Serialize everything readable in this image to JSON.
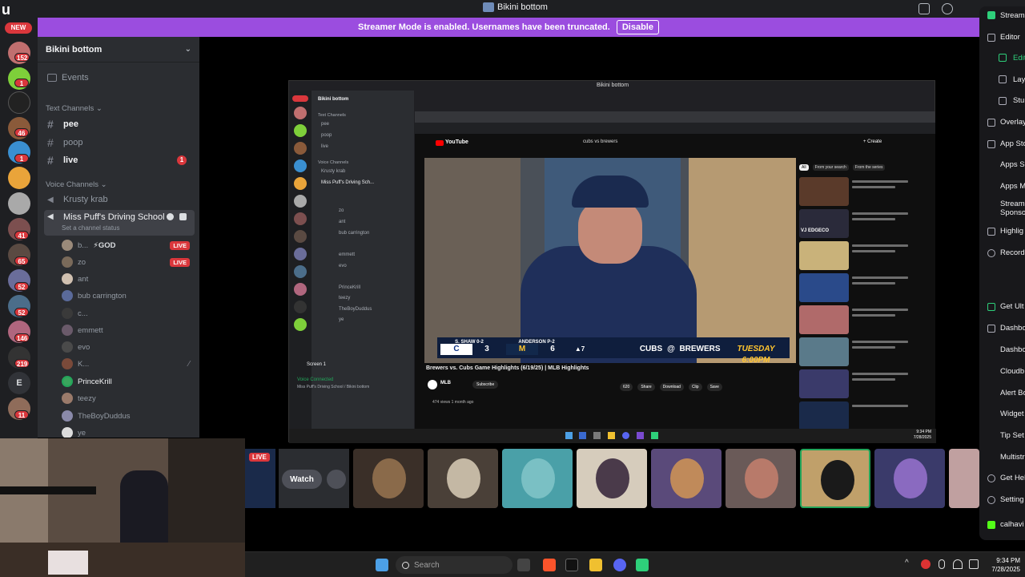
{
  "window": {
    "app_letter": "u",
    "title": "Bikini bottom"
  },
  "banner": {
    "message": "Streamer Mode is enabled. Usernames have been truncated.",
    "disable_label": "Disable"
  },
  "rail": {
    "new_label": "NEW",
    "badges": [
      "152",
      "1",
      "46",
      "1",
      "41",
      "65",
      "52",
      "52",
      "146",
      "219",
      "11"
    ],
    "letter_server": "E"
  },
  "sidebar": {
    "server_name": "Bikini bottom",
    "events_label": "Events",
    "text_category": "Text Channels",
    "text_channels": [
      {
        "name": "pee",
        "bright": true
      },
      {
        "name": "poop",
        "bright": false
      },
      {
        "name": "live",
        "bright": true,
        "badge": "1"
      }
    ],
    "voice_category": "Voice Channels",
    "voice_channels": [
      {
        "name": "Krusty krab"
      },
      {
        "name": "Miss Puff's Driving School",
        "status": "Set a channel status"
      }
    ],
    "voice_users": [
      {
        "name": "b...",
        "extra": "⚡GOD",
        "live": "LIVE"
      },
      {
        "name": "zo",
        "live": "LIVE"
      },
      {
        "name": "ant"
      },
      {
        "name": "bub carrington"
      },
      {
        "name": "c..."
      },
      {
        "name": "emmett"
      },
      {
        "name": "evo"
      },
      {
        "name": "K..."
      },
      {
        "name": "PrinceKrill",
        "bright": true
      },
      {
        "name": "teezy"
      },
      {
        "name": "TheBoyDuddus"
      },
      {
        "name": "ye"
      }
    ]
  },
  "nested": {
    "title": "Bikini bottom",
    "server_name": "Bikini bottom",
    "text_category": "Text Channels",
    "channels": [
      "pee",
      "poop",
      "live"
    ],
    "voice_category": "Voice Channels",
    "voice_channels": [
      "Krusty krab",
      "Miss Puff's Driving Sch..."
    ],
    "users": [
      "zo",
      "ant",
      "bub carrington",
      "emmett",
      "evo",
      "PrinceKrill",
      "teezy",
      "TheBoyDuddus",
      "ye"
    ],
    "screen_label": "Screen 1",
    "voice_connected": "Voice Connected",
    "voice_location": "Miss Puff's Driving School / Bikini bottom",
    "youtube_label": "YouTube",
    "search_query": "cubs vs brewers",
    "create_label": "+ Create",
    "filters": [
      "All",
      "From your search",
      "From the series"
    ],
    "video_title": "Brewers vs. Cubs Game Highlights (6/19/25) | MLB Highlights",
    "channel": "MLB",
    "subscribe": "Subscribe",
    "views": "474 views  1 month ago",
    "actions": [
      "620",
      "Share",
      "Download",
      "Clip",
      "Save"
    ],
    "scorebug": {
      "pitcher1": "S. SHAW 0-2",
      "team1_score": "3",
      "pitcher2": "ANDERSON P-2",
      "team2_score": "6",
      "inning": "▲7",
      "promo_team1": "CUBS",
      "promo_vs": "@",
      "promo_team2": "BREWERS",
      "promo_time": "TUESDAY 6:00PM"
    },
    "thumb_overlay": "VJ EDGECO",
    "clock_time": "9:34 PM",
    "clock_date": "7/28/2025"
  },
  "stream_tiles": {
    "live_label": "LIVE",
    "watch_label": "Watch"
  },
  "taskbar": {
    "search_placeholder": "Search",
    "time": "9:34 PM",
    "date": "7/28/2025"
  },
  "right_menu": {
    "items": [
      "Stream",
      "Editor",
      "Editor",
      "Lay",
      "Stu",
      "Overlay",
      "App Sto",
      "Apps S",
      "Apps M",
      "Stream Sponso",
      "Highlig",
      "Recordi",
      "Get Ult",
      "Dashbo",
      "Dashbo",
      "Cloudb",
      "Alert Bo",
      "Widget",
      "Tip Set",
      "Multistr",
      "Get Hel",
      "Setting",
      "calhavi"
    ]
  },
  "colors": {
    "blurple": "#9b4ddf",
    "live_red": "#da373c",
    "sidebar": "#2b2d31",
    "rail": "#1e1f22"
  }
}
